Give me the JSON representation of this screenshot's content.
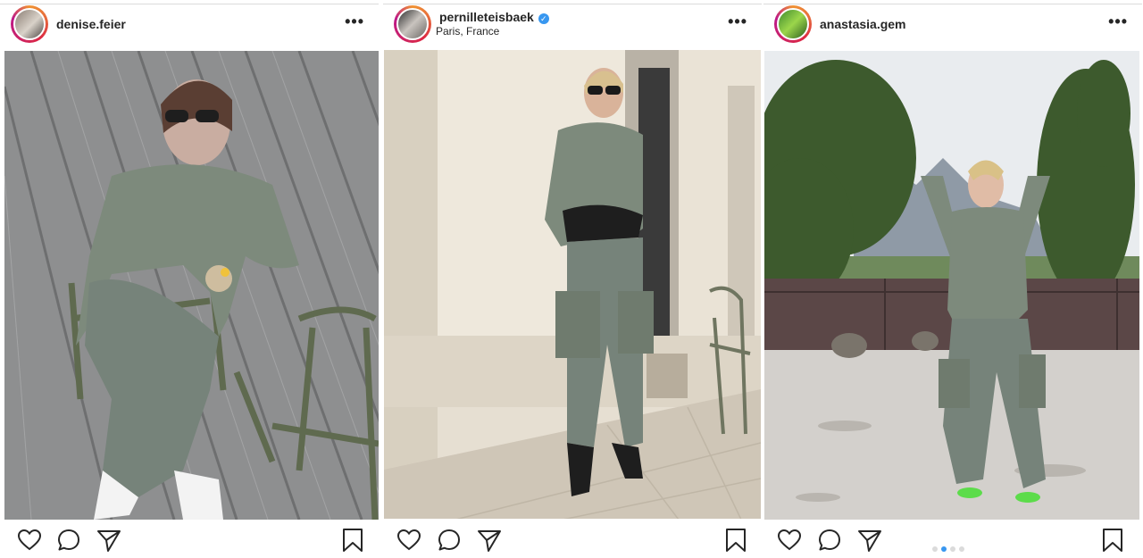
{
  "posts": [
    {
      "username": "denise.feier",
      "location": "",
      "verified": false,
      "more_label": "•••",
      "carousel": null
    },
    {
      "username": "pernilleteisbaek",
      "location": "Paris, France",
      "verified": true,
      "more_label": "•••",
      "carousel": null
    },
    {
      "username": "anastasia.gem",
      "location": "",
      "verified": false,
      "more_label": "•••",
      "carousel": {
        "count": 4,
        "active_index": 1
      }
    }
  ],
  "icons": [
    "heart-icon",
    "comment-icon",
    "share-icon",
    "bookmark-icon",
    "more-icon",
    "verified-icon"
  ],
  "colors": {
    "text": "#262626",
    "accent_blue": "#3897f0",
    "inactive_dot": "#dbdbdb",
    "jumpsuit": "#7d8a7c"
  }
}
